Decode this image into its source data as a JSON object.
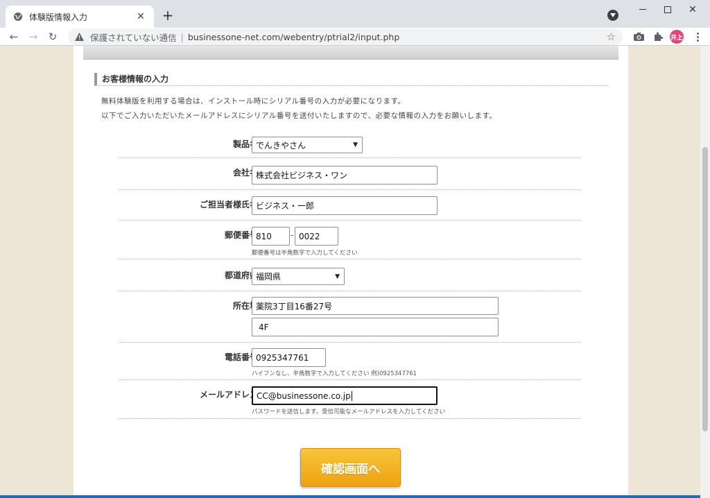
{
  "browser": {
    "tab_title": "体験版情報入力",
    "new_tab": "+",
    "security_label": "保護されていない通信",
    "separator": "|",
    "url": "businessone-net.com/webentry/ptrial2/input.php",
    "avatar_label": "井上"
  },
  "section": {
    "title": "お客様情報の入力",
    "intro_line1": "無料体験版を利用する場合は、インストール時にシリアル番号の入力が必要になります。",
    "intro_line2": "以下でご入力いただいたメールアドレスにシリアル番号を送付いたしますので、必要な情報の入力をお願いします。"
  },
  "required_mark": "※",
  "form": {
    "product": {
      "label": "製品名",
      "value": "でんきやさん"
    },
    "company": {
      "label": "会社名",
      "value": "株式会社ビジネス・ワン"
    },
    "contact": {
      "label": "ご担当者様氏名",
      "value": "ビジネス・一郎"
    },
    "postal": {
      "label": "郵便番号",
      "value1": "810",
      "dash": "-",
      "value2": "0022",
      "hint": "郵便番号は半角数字で入力してください"
    },
    "prefecture": {
      "label": "都道府県",
      "value": "福岡県"
    },
    "address": {
      "label": "所在地",
      "value1": "薬院3丁目16番27号",
      "value2": "4F"
    },
    "phone": {
      "label": "電話番号",
      "value": "0925347761",
      "hint": "ハイフンなし、半角数字で入力してください 例)0925347761"
    },
    "email": {
      "label": "メールアドレス",
      "value": "CC@businessone.co.jp",
      "hint": "パスワードを送信します。受信可能なメールアドレスを入力してください"
    }
  },
  "submit_label": "確認画面へ"
}
